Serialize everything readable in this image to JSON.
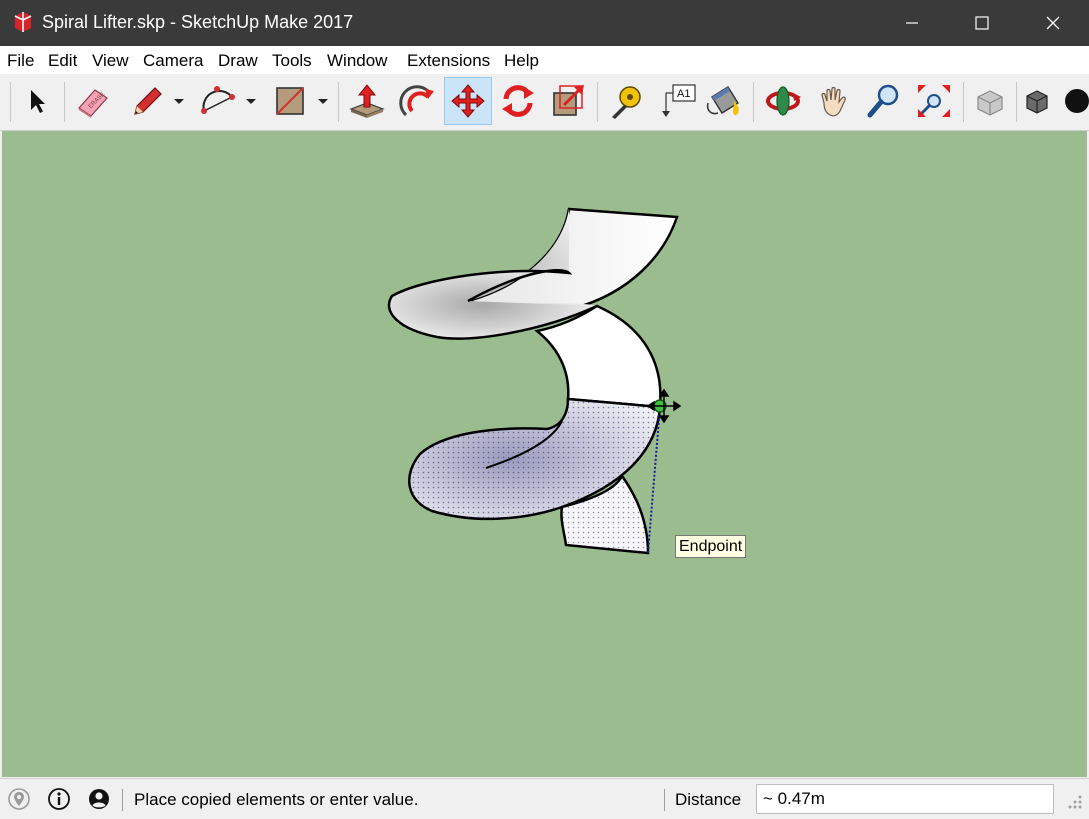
{
  "window": {
    "title": "Spiral Lifter.skp - SketchUp Make 2017",
    "app_icon": "sketchup-logo-icon"
  },
  "menu": [
    "File",
    "Edit",
    "View",
    "Camera",
    "Draw",
    "Tools",
    "Window",
    "Extensions",
    "Help"
  ],
  "toolbar": {
    "tools": [
      "select",
      "eraser",
      "line",
      "arc",
      "rectangle",
      "push-pull",
      "follow-me",
      "move",
      "rotate",
      "scale",
      "tape-measure",
      "text",
      "paint-bucket",
      "orbit",
      "pan",
      "zoom",
      "zoom-extents",
      "components",
      "solid-tools"
    ],
    "active_tool": "move",
    "eraser_label": "ERASE",
    "text_label": "A1"
  },
  "viewport": {
    "background_color": "#9bbc8f",
    "inference_tooltip": "Endpoint"
  },
  "status": {
    "message": "Place copied elements or enter value.",
    "measurement_label": "Distance",
    "measurement_value": "~ 0.47m"
  },
  "colors": {
    "titlebar": "#3a3a3a",
    "active_tool": "#cce4f7",
    "selection_blue": "#1a1a9a"
  }
}
